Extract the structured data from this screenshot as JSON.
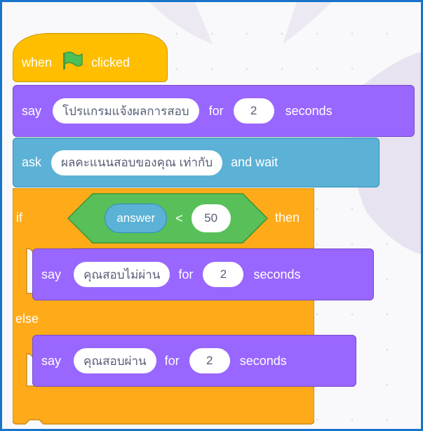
{
  "colors": {
    "looks": "#9966ff",
    "sensing": "#5cb1d6",
    "control": "#ffab19",
    "events": "#ffbf00",
    "operators": "#59c059",
    "flag": "#4cbf56",
    "frame": "#1874c9"
  },
  "hat": {
    "when": "when",
    "flag_icon": "green-flag-icon",
    "clicked": "clicked"
  },
  "say1": {
    "keyword": "say",
    "message": "โปรแกรมแจ้งผลการสอบ",
    "for": "for",
    "secs": "2",
    "seconds": "seconds"
  },
  "ask": {
    "keyword": "ask",
    "question": "ผลคะแนนสอบของคุณ เท่ากับ",
    "and_wait": "and wait"
  },
  "if_else": {
    "if": "if",
    "then": "then",
    "else": "else",
    "condition": {
      "left": "answer",
      "operator": "<",
      "right": "50"
    }
  },
  "say_fail": {
    "keyword": "say",
    "message": "คุณสอบไม่ผ่าน",
    "for": "for",
    "secs": "2",
    "seconds": "seconds"
  },
  "say_pass": {
    "keyword": "say",
    "message": "คุณสอบผ่าน",
    "for": "for",
    "secs": "2",
    "seconds": "seconds"
  }
}
